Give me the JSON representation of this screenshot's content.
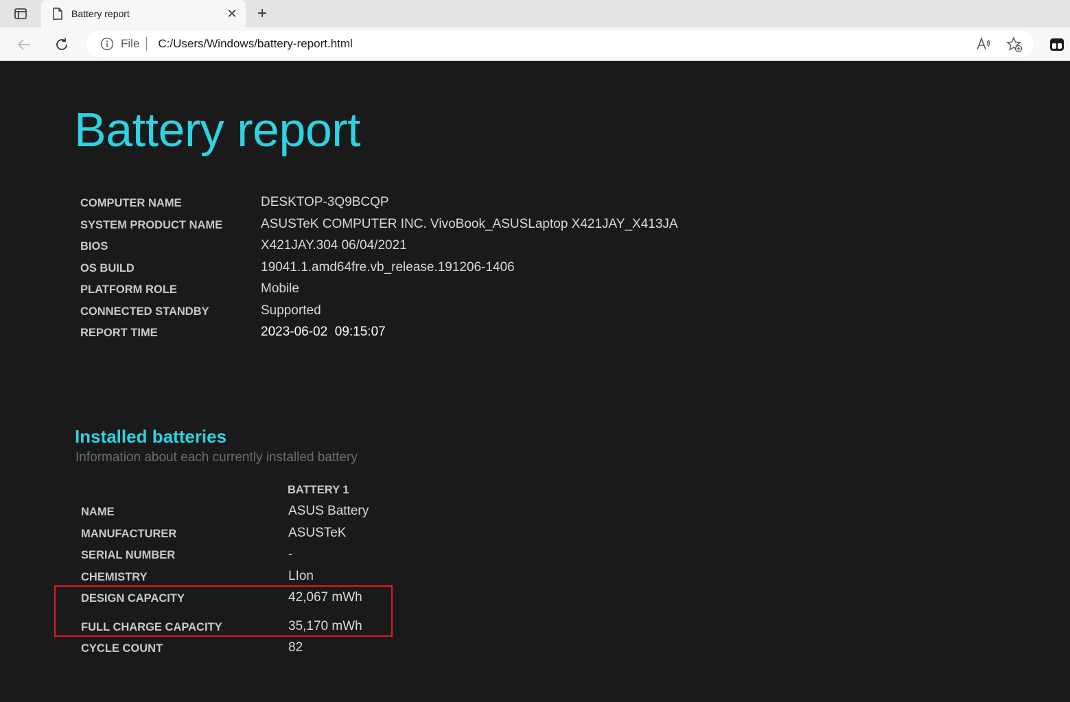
{
  "browser": {
    "tab_title": "Battery report",
    "address_scheme": "File",
    "url": "C:/Users/Windows/battery-report.html",
    "icons": {
      "tab_actions": "tab-actions-icon",
      "page": "page-icon",
      "close": "close-icon",
      "new_tab": "plus-icon",
      "back": "back-arrow-icon",
      "refresh": "refresh-icon",
      "info": "info-icon",
      "read_aloud": "read-aloud-icon",
      "favorites": "add-favorite-icon",
      "profile": "profile-icon"
    }
  },
  "report": {
    "title": "Battery report",
    "system_info": [
      {
        "label": "COMPUTER NAME",
        "value": "DESKTOP-3Q9BCQP"
      },
      {
        "label": "SYSTEM PRODUCT NAME",
        "value": "ASUSTeK COMPUTER INC. VivoBook_ASUSLaptop X421JAY_X413JA"
      },
      {
        "label": "BIOS",
        "value": "X421JAY.304 06/04/2021"
      },
      {
        "label": "OS BUILD",
        "value": "19041.1.amd64fre.vb_release.191206-1406"
      },
      {
        "label": "PLATFORM ROLE",
        "value": "Mobile"
      },
      {
        "label": "CONNECTED STANDBY",
        "value": "Supported"
      },
      {
        "label": "REPORT TIME",
        "value": "2023-06-02  09:15:07"
      }
    ],
    "installed": {
      "title": "Installed batteries",
      "subtitle": "Information about each currently installed battery",
      "column_header": "BATTERY 1",
      "rows": [
        {
          "label": "NAME",
          "value": "ASUS Battery"
        },
        {
          "label": "MANUFACTURER",
          "value": "ASUSTeK"
        },
        {
          "label": "SERIAL NUMBER",
          "value": "-"
        },
        {
          "label": "CHEMISTRY",
          "value": "LIon"
        },
        {
          "label": "DESIGN CAPACITY",
          "value": "42,067 mWh"
        },
        {
          "label": "FULL CHARGE CAPACITY",
          "value": "35,170 mWh"
        },
        {
          "label": "CYCLE COUNT",
          "value": "82"
        }
      ]
    }
  },
  "colors": {
    "accent": "#2ed3e3",
    "background": "#1a1a1a",
    "highlight": "#e11b1b"
  }
}
